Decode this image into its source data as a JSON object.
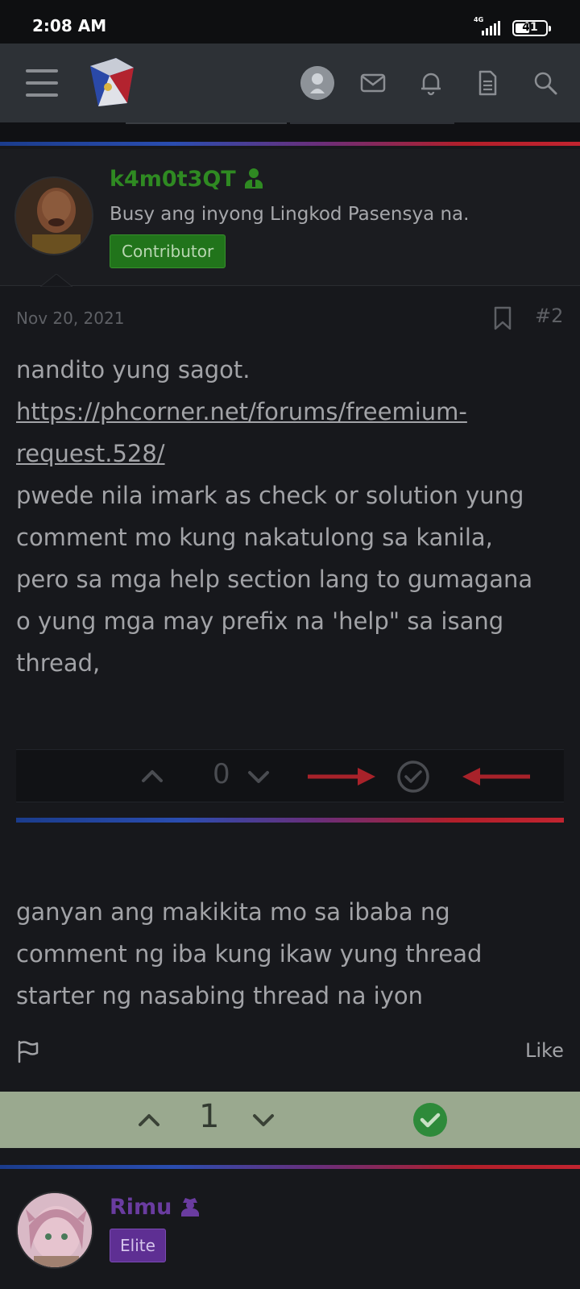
{
  "status_bar": {
    "time": "2:08 AM",
    "network": "4G",
    "battery": "41"
  },
  "header": {
    "icons": [
      "menu-icon",
      "site-logo",
      "user-avatar",
      "mail-icon",
      "bell-icon",
      "document-icon",
      "search-icon"
    ]
  },
  "post": {
    "author": {
      "username": "k4m0t3QT",
      "title": "Busy ang inyong Lingkod Pasensya na.",
      "badge": "Contributor",
      "name_color": "#2f8a22",
      "badge_color": "#21741b"
    },
    "date": "Nov 20, 2021",
    "number": "#2",
    "paragraph1": "nandito yung sagot.",
    "link_line1": "https://phcorner.net/forums/freemium-",
    "link_line2": "request.528/",
    "body_lines": [
      "pwede nila imark as check or solution yung",
      "comment mo kung nakatulong sa kanila,",
      "pero sa mga help section lang to gumagana",
      "o yung mga may prefix na 'help\" sa isang",
      "thread,"
    ],
    "embedded_vote": {
      "score": "0"
    },
    "paragraph2_lines": [
      "ganyan ang makikita mo sa ibaba ng",
      "comment ng iba kung ikaw yung thread",
      "starter ng nasabing thread na iyon"
    ],
    "like_label": "Like",
    "vote": {
      "score": "1",
      "solution_color": "#2e8a3a",
      "bar_color": "#9aa98f"
    }
  },
  "next_post": {
    "author": {
      "username": "Rimu",
      "badge": "Elite",
      "name_color": "#6a3ca0",
      "badge_color": "#5e2f93"
    }
  }
}
